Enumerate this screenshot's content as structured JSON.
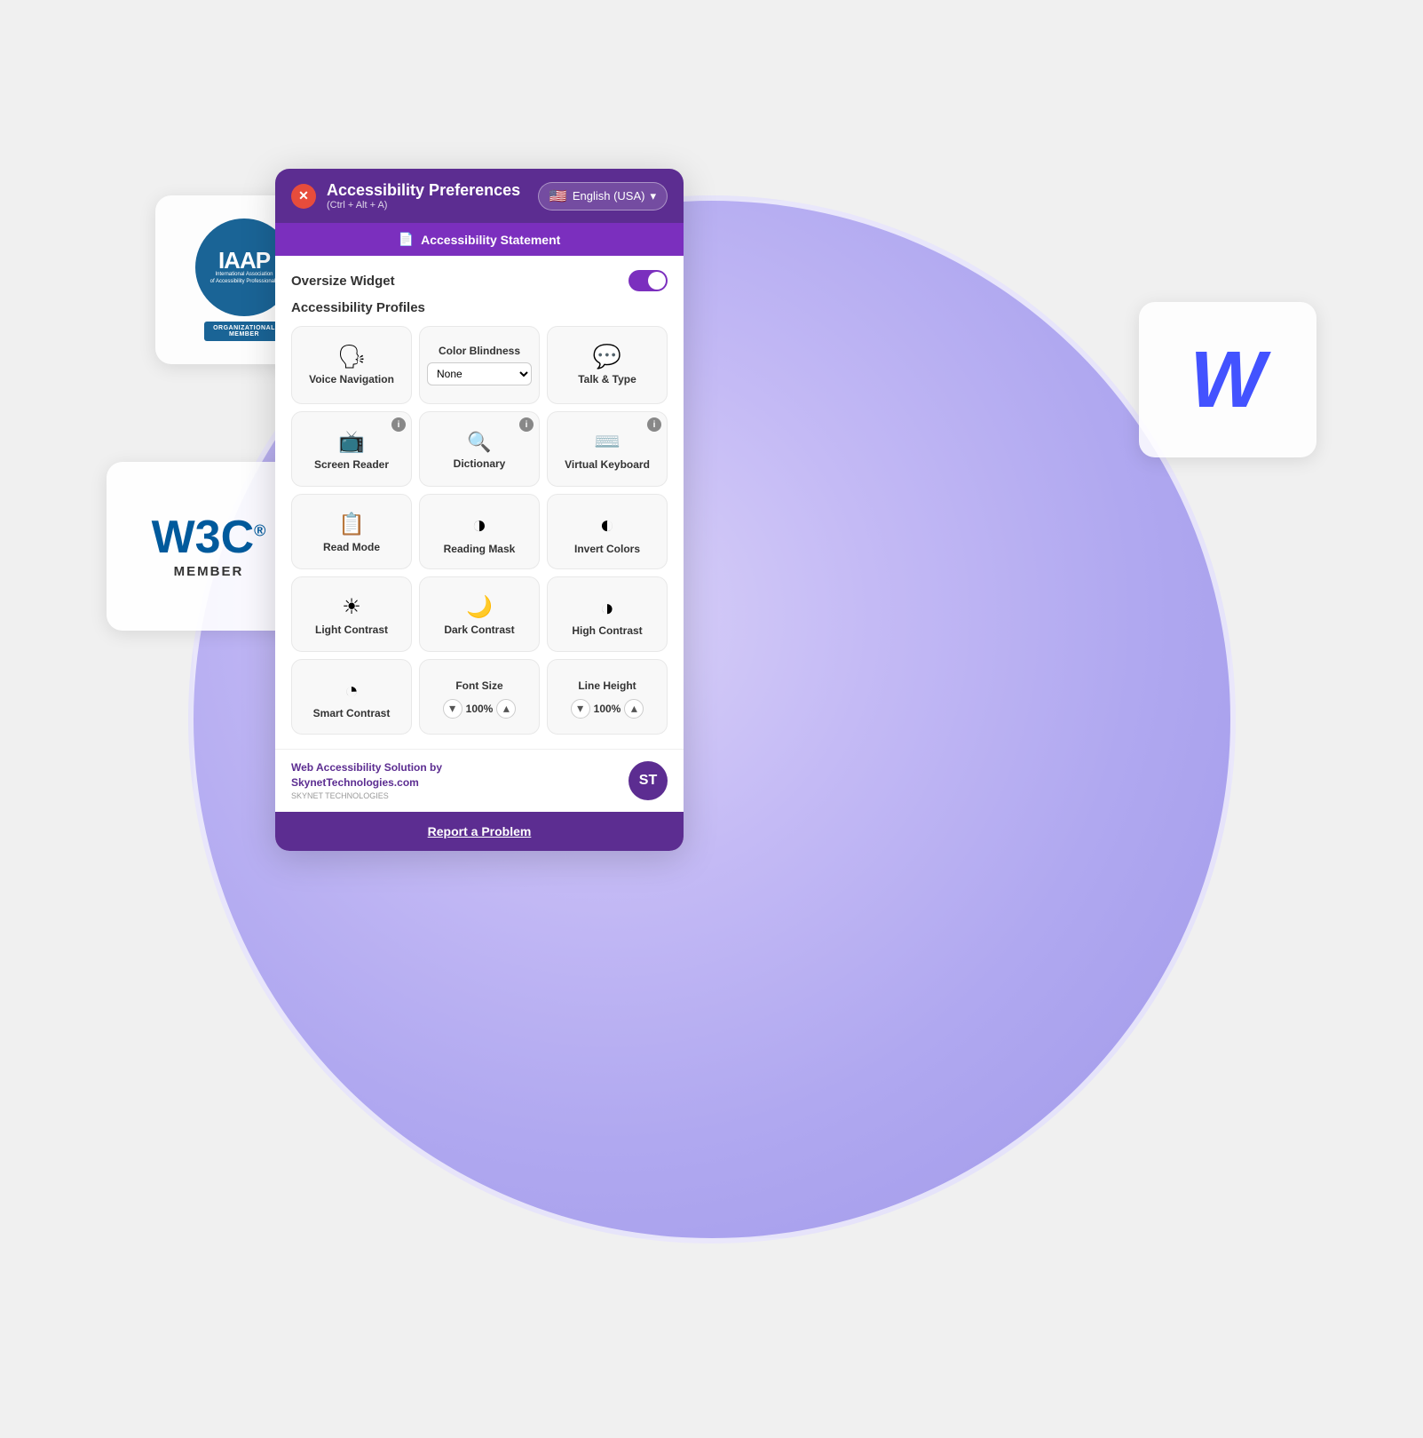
{
  "scene": {
    "circle_color_start": "#d8d0f8",
    "circle_color_end": "#9e96e8"
  },
  "panel": {
    "header": {
      "title": "Accessibility Preferences",
      "subtitle": "(Ctrl + Alt + A)",
      "close_label": "✕",
      "language_label": "English (USA)",
      "flag_emoji": "🇺🇸",
      "chevron": "▾"
    },
    "statement_bar": {
      "icon": "📄",
      "label": "Accessibility Statement"
    },
    "oversize": {
      "label": "Oversize Widget",
      "toggle_on": true
    },
    "profiles": {
      "label": "Accessibility Profiles"
    },
    "top_row": [
      {
        "id": "voice-navigation",
        "icon": "🗣",
        "label": "Voice Navigation"
      },
      {
        "id": "color-blindness",
        "label": "Color Blindness",
        "select_default": "None"
      },
      {
        "id": "talk-type",
        "icon": "💬",
        "label": "Talk & Type"
      }
    ],
    "features": [
      {
        "id": "screen-reader",
        "icon": "📺",
        "label": "Screen Reader",
        "info": true
      },
      {
        "id": "dictionary",
        "icon": "🔍",
        "label": "Dictionary",
        "info": true
      },
      {
        "id": "virtual-keyboard",
        "icon": "⌨️",
        "label": "Virtual Keyboard",
        "info": true
      },
      {
        "id": "read-mode",
        "icon": "📋",
        "label": "Read Mode",
        "info": false
      },
      {
        "id": "reading-mask",
        "icon": "◑",
        "label": "Reading Mask",
        "info": false
      },
      {
        "id": "invert-colors",
        "icon": "◐",
        "label": "Invert Colors",
        "info": false
      },
      {
        "id": "light-contrast",
        "icon": "☀",
        "label": "Light Contrast",
        "info": false
      },
      {
        "id": "dark-contrast",
        "icon": "🌙",
        "label": "Dark Contrast",
        "info": false
      },
      {
        "id": "high-contrast",
        "icon": "◑",
        "label": "High Contrast",
        "info": false
      },
      {
        "id": "smart-contrast",
        "icon": "◔",
        "label": "Smart Contrast",
        "info": false
      },
      {
        "id": "font-size",
        "icon": null,
        "label": "Font Size",
        "stepper": true,
        "value": "100%"
      },
      {
        "id": "line-height",
        "icon": null,
        "label": "Line Height",
        "stepper": true,
        "value": "100%"
      }
    ],
    "footer": {
      "text_line1": "Web Accessibility Solution by",
      "text_line2": "SkynetTechnologies.com",
      "logo_text": "ST"
    },
    "report": {
      "label": "Report a Problem"
    }
  },
  "iaap": {
    "main": "IAAP",
    "sub_line1": "International Association",
    "sub_line2": "of Accessibility Professionals",
    "org_label": "ORGANIZATIONAL",
    "member_label": "MEMBER"
  },
  "w3c": {
    "logo": "W3C",
    "reg_symbol": "®",
    "member": "MEMBER"
  }
}
